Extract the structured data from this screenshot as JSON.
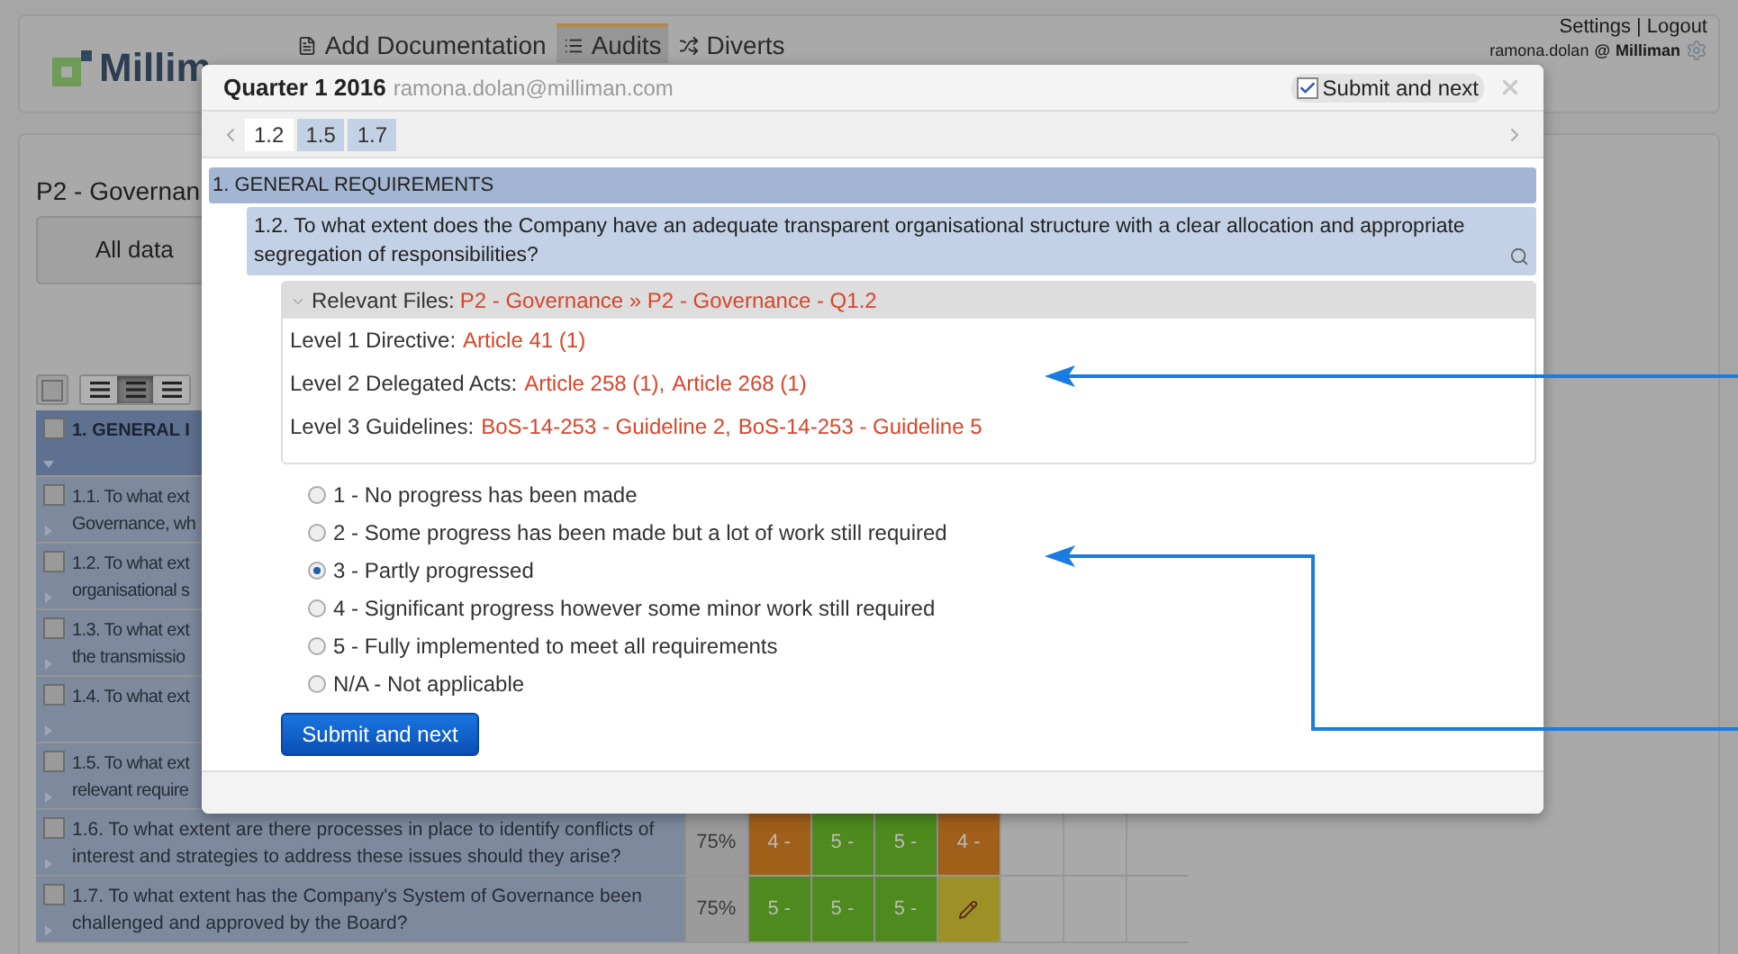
{
  "header": {
    "logo": "Millim",
    "nav": [
      {
        "label": "Add Documentation",
        "selected": false
      },
      {
        "label": "Audits",
        "selected": true
      },
      {
        "label": "Diverts",
        "selected": false
      }
    ],
    "links": [
      "Settings",
      "Logout"
    ],
    "separator": "|",
    "user": "ramona.dolan",
    "at": "@",
    "org": "Milliman"
  },
  "page": {
    "title": "P2 - Governan",
    "filter_button": "All data",
    "toolbar": {
      "select_all_checked": false,
      "align_buttons": [
        {
          "selected": false
        },
        {
          "selected": true
        },
        {
          "selected": false
        }
      ]
    },
    "rows": [
      {
        "kind": "section",
        "lines": [
          "1. GENERAL I"
        ],
        "checked": false
      },
      {
        "kind": "question",
        "lines": [
          "1.1. To what ext",
          "Governance, wh"
        ],
        "checked": false
      },
      {
        "kind": "question",
        "lines": [
          "1.2. To what ext",
          "organisational s"
        ],
        "checked": false
      },
      {
        "kind": "question",
        "lines": [
          "1.3. To what ext",
          "the transmissio"
        ],
        "checked": false
      },
      {
        "kind": "question",
        "lines": [
          "1.4. To what ext"
        ],
        "checked": false
      },
      {
        "kind": "question",
        "lines": [
          "1.5. To what ext",
          "relevant require"
        ],
        "checked": false
      },
      {
        "kind": "question",
        "lines": [
          "1.6. To what extent are there processes in place to identify conflicts of",
          "interest and strategies to address these issues should they arise?"
        ],
        "checked": false,
        "percent": "75%",
        "scores": [
          {
            "kind": "text",
            "text": "4 -",
            "color": "#a1601a"
          },
          {
            "kind": "text",
            "text": "5 -",
            "color": "#4f8a1f"
          },
          {
            "kind": "text",
            "text": "5 -",
            "color": "#4f8a1f"
          },
          {
            "kind": "text",
            "text": "4 -",
            "color": "#a1601a"
          }
        ]
      },
      {
        "kind": "question",
        "lines": [
          "1.7. To what extent has the Company's System of Governance been",
          "challenged and approved by the Board?"
        ],
        "checked": false,
        "percent": "75%",
        "scores": [
          {
            "kind": "text",
            "text": "5 -",
            "color": "#4f8a1f"
          },
          {
            "kind": "text",
            "text": "5 -",
            "color": "#4f8a1f"
          },
          {
            "kind": "text",
            "text": "5 -",
            "color": "#4f8a1f"
          },
          {
            "kind": "edit",
            "color": "#9c9027"
          }
        ]
      }
    ]
  },
  "dialog": {
    "title": "Quarter 1 2016",
    "user": "ramona.dolan@milliman.com",
    "submit_toggle": {
      "label": "Submit and next",
      "checked": true
    },
    "tabs": [
      {
        "label": "1.2",
        "selected": true
      },
      {
        "label": "1.5",
        "selected": false
      },
      {
        "label": "1.7",
        "selected": false
      }
    ],
    "section": "1. GENERAL REQUIREMENTS",
    "question": "1.2. To what extent does the Company have an adequate transparent organisational structure with a clear allocation and appropriate segregation of responsibilities?",
    "relevant_files": {
      "label": "Relevant Files:",
      "path": "P2 - Governance » P2 - Governance - Q1.2"
    },
    "levels": [
      {
        "label": "Level 1 Directive:",
        "links": [
          "Article 41 (1)"
        ]
      },
      {
        "label": "Level 2 Delegated Acts:",
        "links": [
          "Article 258 (1),",
          "Article 268 (1)"
        ]
      },
      {
        "label": "Level 3 Guidelines:",
        "links": [
          "BoS-14-253 - Guideline 2,",
          "BoS-14-253 - Guideline 5"
        ]
      }
    ],
    "options": [
      {
        "label": "1 - No progress has been made",
        "selected": false
      },
      {
        "label": "2 - Some progress has been made but a lot of work still required",
        "selected": false
      },
      {
        "label": "3 - Partly progressed",
        "selected": true
      },
      {
        "label": "4 - Significant progress however some minor work still required",
        "selected": false
      },
      {
        "label": "5 - Fully implemented to meet all requirements",
        "selected": false
      },
      {
        "label": "N/A - Not applicable",
        "selected": false
      }
    ],
    "submit_button": "Submit and next"
  }
}
